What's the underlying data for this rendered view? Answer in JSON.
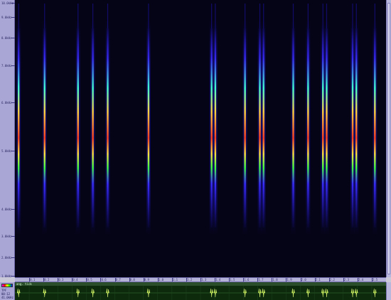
{
  "frequency_axis": {
    "top_label": "10.0kHz",
    "ticks": [
      "9.0kHz",
      "8.0kHz",
      "7.0kHz",
      "6.0kHz",
      "5.0kHz",
      "4.0kHz",
      "3.0kHz",
      "2.0kHz"
    ],
    "bottom_label": "1.0kHz"
  },
  "time_axis": {
    "ticks": [
      "0.1",
      "0.2",
      "0.3",
      "0.4",
      "0.5",
      "0.6",
      "0.7",
      "0.8",
      "0.9",
      "1.0",
      "1.1",
      "1.2",
      "1.3",
      "1.4",
      "1.5",
      "1.6",
      "1.7",
      "1.8",
      "1.9",
      "2.0",
      "2.1",
      "2.2",
      "2.3",
      "2.4",
      "2.5"
    ]
  },
  "waveform": {
    "title": "ang. tick"
  },
  "info_panel": {
    "line1": "TPF",
    "line2": "00:12",
    "line3": "41.0kHz"
  },
  "spectrogram": {
    "calls_time_fraction": [
      0.01,
      0.08,
      0.17,
      0.21,
      0.25,
      0.36,
      0.53,
      0.54,
      0.62,
      0.66,
      0.67,
      0.75,
      0.79,
      0.83,
      0.84,
      0.91,
      0.92,
      0.97
    ],
    "colors": {
      "background": "#050417",
      "low": "#2a1cff",
      "mid": "#40ff40",
      "high": "#ff4020"
    }
  }
}
